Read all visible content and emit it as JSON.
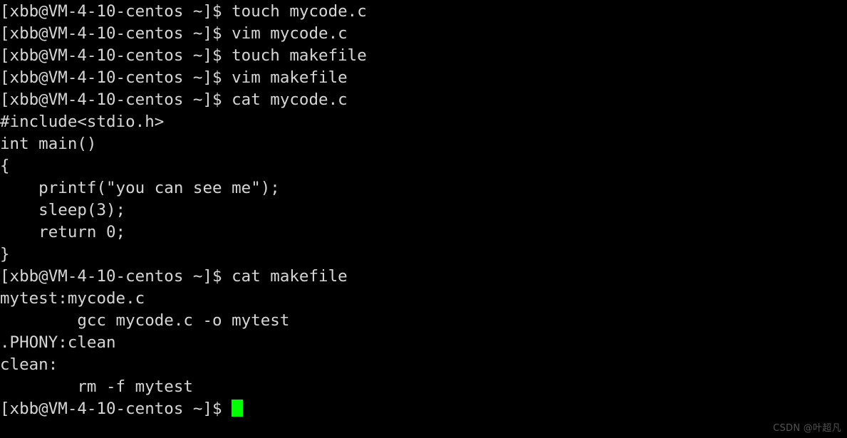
{
  "terminal": {
    "background_color": "#000000",
    "foreground_color": "#d6d6d6",
    "cursor_color": "#00ff00",
    "prompt": "[xbb@VM-4-10-centos ~]$ ",
    "lines": [
      "[xbb@VM-4-10-centos ~]$ touch mycode.c",
      "[xbb@VM-4-10-centos ~]$ vim mycode.c",
      "[xbb@VM-4-10-centos ~]$ touch makefile",
      "[xbb@VM-4-10-centos ~]$ vim makefile",
      "[xbb@VM-4-10-centos ~]$ cat mycode.c",
      "#include<stdio.h>",
      "int main()",
      "{",
      "    printf(\"you can see me\");",
      "    sleep(3);",
      "    return 0;",
      "}",
      "[xbb@VM-4-10-centos ~]$ cat makefile",
      "mytest:mycode.c",
      "        gcc mycode.c -o mytest",
      ".PHONY:clean",
      "clean:",
      "        rm -f mytest"
    ],
    "last_prompt": "[xbb@VM-4-10-centos ~]$ ",
    "cursor_visible": true
  },
  "watermark": {
    "text": "CSDN @叶超凡"
  }
}
